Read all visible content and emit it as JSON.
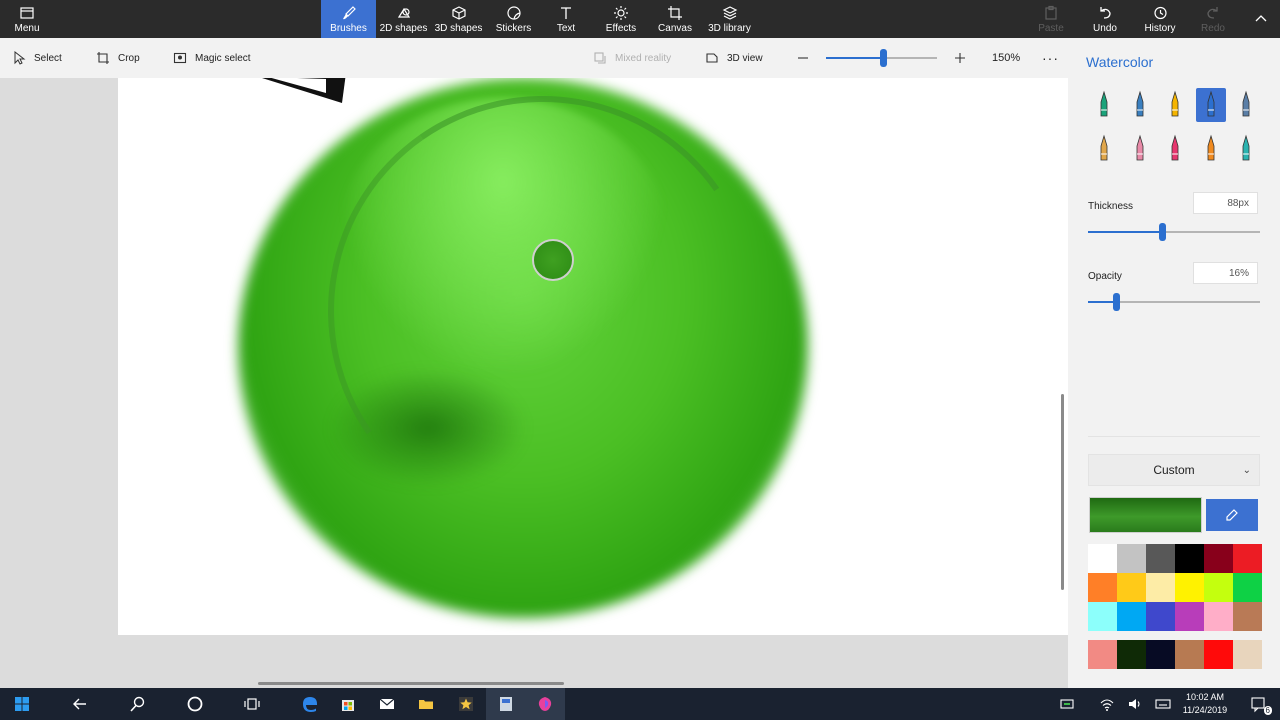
{
  "ribbon": {
    "menu_label": "Menu",
    "tabs": [
      {
        "label": "Brushes",
        "icon": "brush-icon",
        "active": true
      },
      {
        "label": "2D shapes",
        "icon": "2d-shapes-icon"
      },
      {
        "label": "3D shapes",
        "icon": "3d-shapes-icon"
      },
      {
        "label": "Stickers",
        "icon": "stickers-icon"
      },
      {
        "label": "Text",
        "icon": "text-icon"
      },
      {
        "label": "Effects",
        "icon": "effects-icon"
      },
      {
        "label": "Canvas",
        "icon": "canvas-icon"
      },
      {
        "label": "3D library",
        "icon": "3d-library-icon"
      }
    ],
    "paste_label": "Paste",
    "undo_label": "Undo",
    "history_label": "History",
    "redo_label": "Redo"
  },
  "subbar": {
    "select_label": "Select",
    "crop_label": "Crop",
    "magic_select_label": "Magic select",
    "mixed_reality_label": "Mixed reality",
    "view_3d_label": "3D view",
    "zoom_label": "150%",
    "zoom_fraction": 0.51
  },
  "panel": {
    "title": "Watercolor",
    "brushes_row1": [
      {
        "icon": "marker-icon",
        "color": "#1aa37a"
      },
      {
        "icon": "calligraphy-pen-icon",
        "color": "#3a7fbf"
      },
      {
        "icon": "oil-brush-icon",
        "color": "#f4b400"
      },
      {
        "icon": "watercolor-brush-icon",
        "color": "#2b6fcf",
        "selected": true
      },
      {
        "icon": "pixel-pen-icon",
        "color": "#5a7ea6"
      }
    ],
    "brushes_row2": [
      {
        "icon": "pencil-icon",
        "color": "#e0a64a"
      },
      {
        "icon": "eraser-icon",
        "color": "#e88aa8"
      },
      {
        "icon": "crayon-icon",
        "color": "#e6356e"
      },
      {
        "icon": "spray-can-icon",
        "color": "#f08a1f"
      },
      {
        "icon": "fill-icon",
        "color": "#2bb3b0"
      }
    ],
    "thickness_label": "Thickness",
    "thickness_value": "88px",
    "thickness_fraction": 0.43,
    "opacity_label": "Opacity",
    "opacity_value": "16%",
    "opacity_fraction": 0.16,
    "color_mode_label": "Custom",
    "current_color": "#2f8a20",
    "palette": [
      [
        "#ffffff",
        "#c3c3c3",
        "#585858",
        "#000000",
        "#88001b",
        "#ec1c24"
      ],
      [
        "#ff7f27",
        "#ffca18",
        "#fdeca6",
        "#fff200",
        "#c4ff0e",
        "#0ed145"
      ],
      [
        "#8cfffb",
        "#00a8f3",
        "#3f48cc",
        "#b83dba",
        "#ffaec8",
        "#b97a56"
      ]
    ],
    "custom_palette": [
      "#f28a84",
      "#0f2a06",
      "#070b24",
      "#b77a52",
      "#ff0a0a",
      "#e8d5bd"
    ]
  },
  "taskbar": {
    "time": "10:02 AM",
    "date": "11/24/2019",
    "notification_count": "6"
  }
}
